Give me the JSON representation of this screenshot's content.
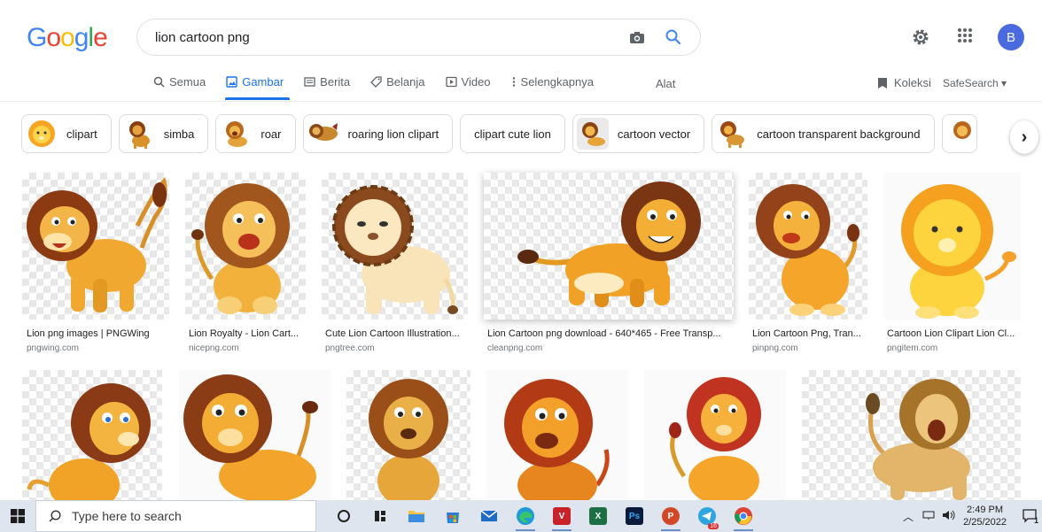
{
  "header": {
    "logo": "Google",
    "logo_colors": [
      "#4285f4",
      "#ea4335",
      "#fbbc05",
      "#4285f4",
      "#34a853",
      "#ea4335"
    ],
    "search_value": "lion cartoon png",
    "avatar_letter": "B"
  },
  "tabs": [
    {
      "label": "Semua",
      "icon": "search-icon"
    },
    {
      "label": "Gambar",
      "icon": "image-icon",
      "active": true
    },
    {
      "label": "Berita",
      "icon": "news-icon"
    },
    {
      "label": "Belanja",
      "icon": "tag-icon"
    },
    {
      "label": "Video",
      "icon": "play-icon"
    },
    {
      "label": "Selengkapnya",
      "icon": "more-vert-icon"
    }
  ],
  "tools_label": "Alat",
  "collections_label": "Koleksi",
  "safesearch_label": "SafeSearch ▾",
  "chips": [
    {
      "label": "clipart",
      "thumb": true
    },
    {
      "label": "simba",
      "thumb": true
    },
    {
      "label": "roar",
      "thumb": true
    },
    {
      "label": "roaring lion clipart",
      "thumb": true
    },
    {
      "label": "clipart cute lion",
      "thumb": false
    },
    {
      "label": "cartoon vector",
      "thumb": true
    },
    {
      "label": "cartoon transparent background",
      "thumb": true
    }
  ],
  "results": [
    {
      "title": "Lion png images | PNGWing",
      "source": "pngwing.com"
    },
    {
      "title": "Lion Royalty - Lion Cart...",
      "source": "nicepng.com"
    },
    {
      "title": "Cute Lion Cartoon Illustration...",
      "source": "pngtree.com"
    },
    {
      "title": "Lion Cartoon png download - 640*465 - Free Transp...",
      "source": "cleanpng.com"
    },
    {
      "title": "Lion Cartoon Png, Tran...",
      "source": "pinpng.com"
    },
    {
      "title": "Cartoon Lion Clipart Lion Cl...",
      "source": "pngitem.com"
    }
  ],
  "taskbar": {
    "search_placeholder": "Type here to search",
    "time": "2:49 PM",
    "date": "2/25/2022",
    "notification_count": "1",
    "telegram_badge": "16"
  }
}
